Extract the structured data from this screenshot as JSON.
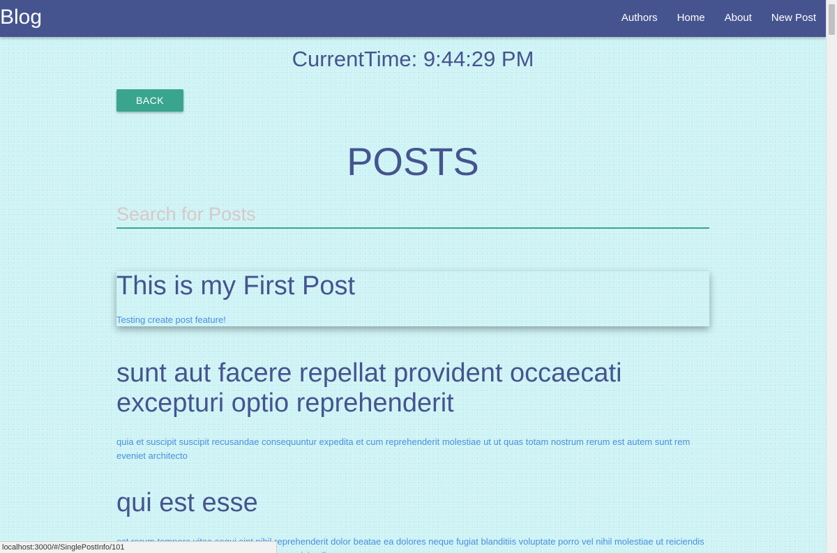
{
  "navbar": {
    "brand": "Blog",
    "links": [
      "Authors",
      "Home",
      "About",
      "New Post"
    ]
  },
  "clock": {
    "text": "CurrentTime: 9:44:29 PM"
  },
  "back_button": {
    "label": "BACK"
  },
  "page": {
    "title": "POSTS"
  },
  "search": {
    "placeholder": "Search for Posts",
    "value": ""
  },
  "posts": [
    {
      "title": "This is my First Post",
      "body": "Testing create post feature!"
    },
    {
      "title": "sunt aut facere repellat provident occaecati excepturi optio reprehenderit",
      "body": "quia et suscipit suscipit recusandae consequuntur expedita et cum reprehenderit molestiae ut ut quas totam nostrum rerum est autem sunt rem eveniet architecto"
    },
    {
      "title": "qui est esse",
      "body": "est rerum tempore vitae sequi sint nihil reprehenderit dolor beatae ea dolores neque fugiat blanditiis voluptate porro vel nihil molestiae ut reiciendis qui aperiam non debitis possimus qui neque nisi nulla"
    }
  ],
  "status_bar": {
    "url": "localhost:3000/#/SinglePostInfo/101"
  },
  "colors": {
    "navbar": "#45548f",
    "accent": "#3aa58e",
    "background": "#cdf3f5",
    "heading": "#45548f",
    "body_text": "#4a8fe0"
  }
}
